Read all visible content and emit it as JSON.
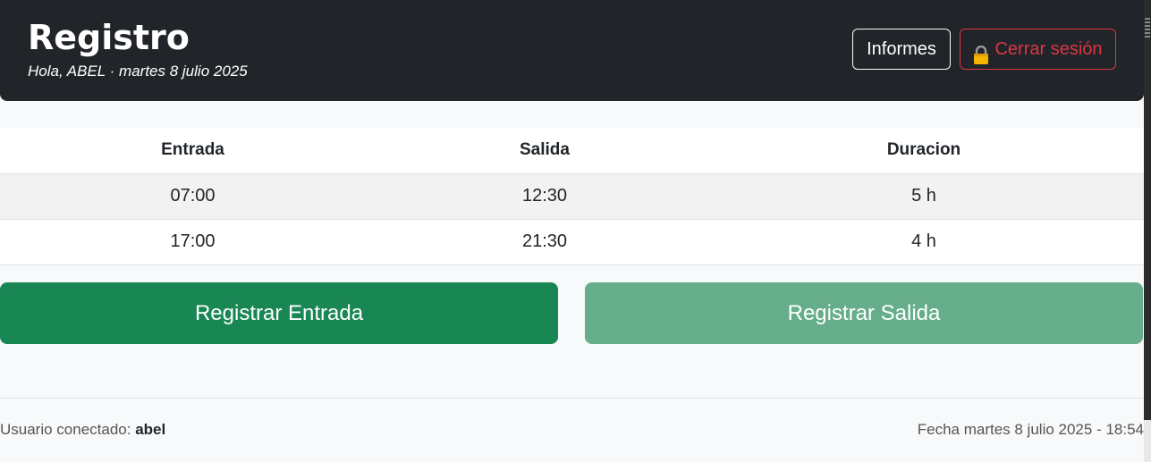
{
  "header": {
    "title": "Registro",
    "subtitle": "Hola, ABEL · martes 8 julio 2025",
    "reports_label": "Informes",
    "logout_label": "Cerrar sesión"
  },
  "table": {
    "headers": [
      "Entrada",
      "Salida",
      "Duracion"
    ],
    "rows": [
      [
        "07:00",
        "12:30",
        "5 h"
      ],
      [
        "17:00",
        "21:30",
        "4 h"
      ]
    ]
  },
  "actions": {
    "entrada_label": "Registrar Entrada",
    "salida_label": "Registrar Salida"
  },
  "footer": {
    "user_prefix": "Usuario conectado: ",
    "user_name": "abel",
    "date_text": "Fecha martes 8 julio 2025 - 18:54"
  },
  "colors": {
    "header_bg": "#212529",
    "success": "#198754",
    "success_disabled": "#66ae8b",
    "danger": "#dc3545"
  },
  "icons": {
    "logout": "lock-icon"
  }
}
